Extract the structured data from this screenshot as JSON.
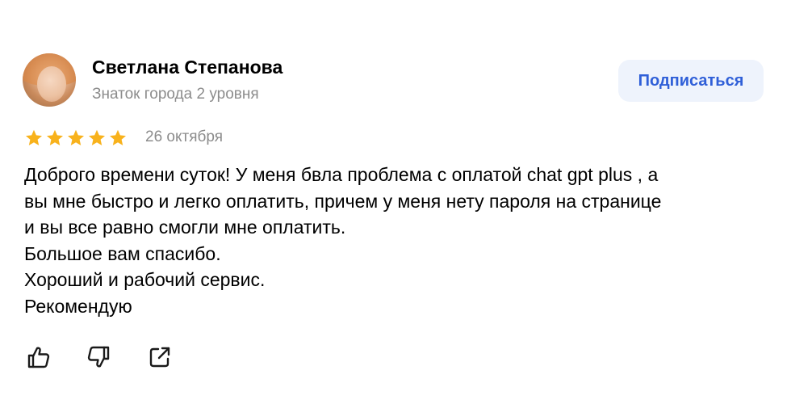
{
  "author": {
    "name": "Светлана Степанова",
    "status": "Знаток города 2 уровня",
    "avatar_icon": "user-avatar-photo"
  },
  "subscribe": {
    "label": "Подписаться",
    "text_color": "#2f5fd8",
    "bg_color": "#eef3fc"
  },
  "rating": {
    "value": 5,
    "max": 5,
    "star_color": "#f8b21c"
  },
  "date": "26 октября",
  "text_lines": [
    "Доброго времени суток! У меня бвла проблема с оплатой chat gpt plus , а",
    "вы мне быстро и легко оплатить, причем у меня нету пароля на странице",
    "и вы все равно смогли мне оплатить.",
    "Большое вам спасибо.",
    "Хороший и рабочий сервис.",
    "Рекомендую"
  ],
  "actions": [
    {
      "name": "like",
      "icon": "thumbs-up-icon"
    },
    {
      "name": "dislike",
      "icon": "thumbs-down-icon"
    },
    {
      "name": "share",
      "icon": "share-icon"
    }
  ]
}
